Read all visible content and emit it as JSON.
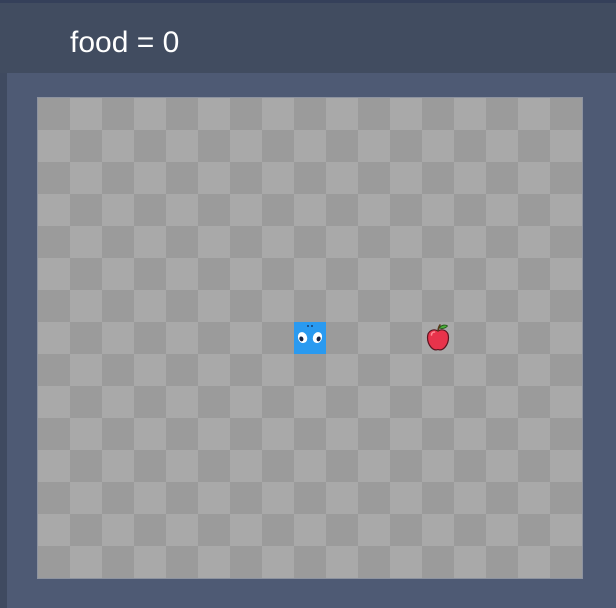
{
  "score": {
    "label": "food",
    "equals": " = ",
    "value": 0
  },
  "board": {
    "columns": 17,
    "rows": 15,
    "colors": {
      "tile_light": "#a9a9a9",
      "tile_dark": "#9b9b9b",
      "frame": "#4e5a74",
      "header": "#414c60"
    }
  },
  "snake": {
    "color": "#2a9af0",
    "direction": "down",
    "segments": [
      {
        "col": 8,
        "row": 7
      }
    ]
  },
  "food": {
    "icon": "apple-icon",
    "col": 12,
    "row": 7,
    "color": "#e8334b"
  }
}
